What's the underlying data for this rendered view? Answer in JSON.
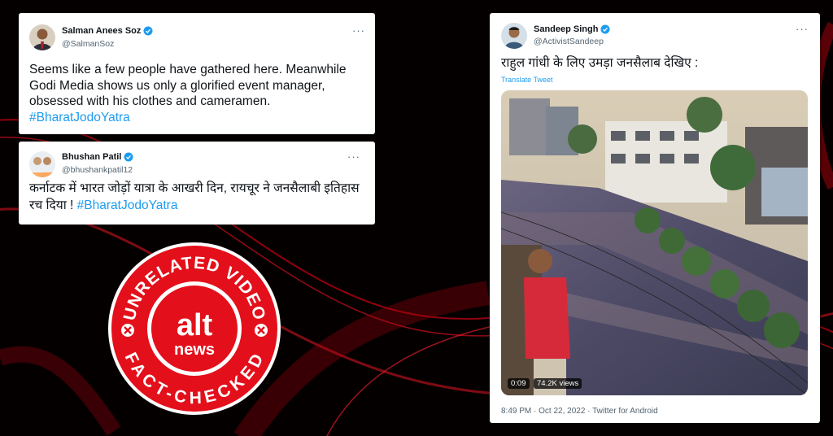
{
  "stamp": {
    "top_text": "UNRELATED VIDEO",
    "bottom_text": "FACT-CHECKED",
    "logo_top": "alt",
    "logo_bottom": "news"
  },
  "tweets": [
    {
      "name": "Salman Anees Soz",
      "handle": "@SalmanSoz",
      "more": "···",
      "body": "Seems like a few people have gathered here. Meanwhile Godi Media shows us only a glorified event manager, obsessed with his clothes and cameramen.",
      "hashtag": "#BharatJodoYatra"
    },
    {
      "name": "Bhushan Patil",
      "handle": "@bhushankpatil12",
      "more": "···",
      "body": "कर्नाटक में भारत जोड़ों यात्रा के आखरी दिन, रायचूर ने जनसैलाबी इतिहास रच दिया !",
      "hashtag": "#BharatJodoYatra"
    },
    {
      "name": "Sandeep Singh",
      "handle": "@ActivistSandeep",
      "more": "···",
      "body": "राहुल गांधी के लिए उमड़ा जनसैलाब देखिए :",
      "translate": "Translate Tweet",
      "video_time": "0:09",
      "video_views": "74.2K views",
      "timestamp": "8:49 PM · Oct 22, 2022 · Twitter for Android"
    }
  ],
  "colors": {
    "background": "#050000",
    "stamp_red": "#e3101b",
    "twitter_blue": "#1d9bf0"
  },
  "icons": [
    "verified-badge-icon",
    "more-options-icon",
    "x-mark-icon"
  ]
}
